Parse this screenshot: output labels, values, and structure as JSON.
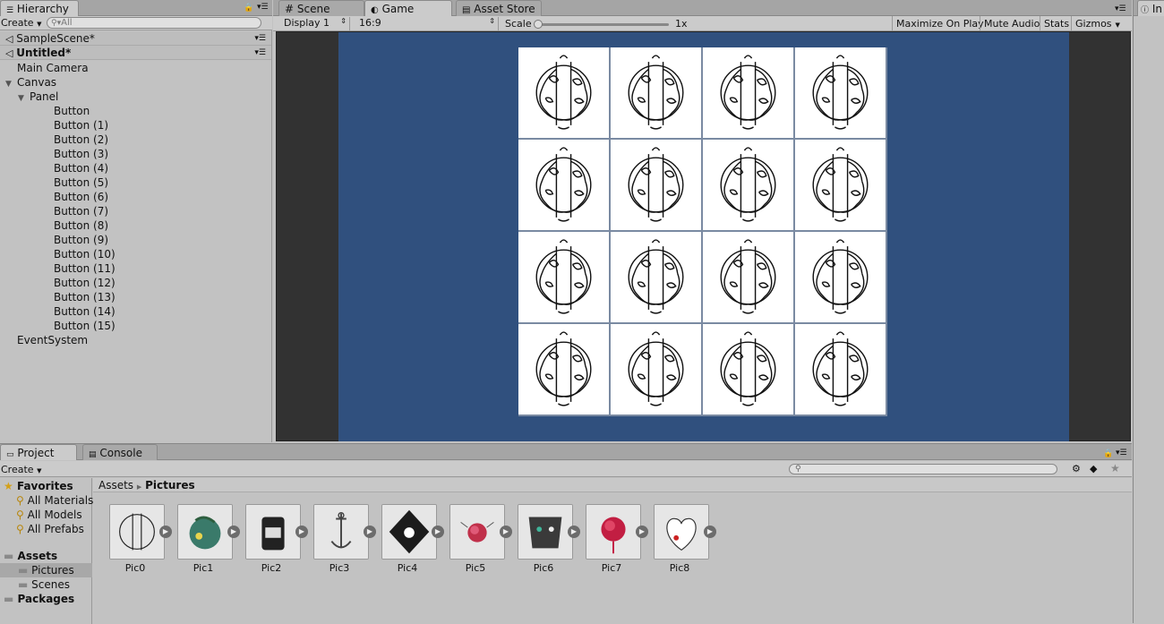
{
  "hierarchy": {
    "tab_label": "Hierarchy",
    "create_label": "Create",
    "search_placeholder": "All",
    "scenes": [
      "SampleScene*",
      "Untitled*"
    ],
    "items": [
      {
        "label": "Main Camera",
        "depth": 0,
        "arrow": ""
      },
      {
        "label": "Canvas",
        "depth": 0,
        "arrow": "▼"
      },
      {
        "label": "Panel",
        "depth": 1,
        "arrow": "▼"
      },
      {
        "label": "Button",
        "depth": 2,
        "arrow": ""
      },
      {
        "label": "Button (1)",
        "depth": 2,
        "arrow": ""
      },
      {
        "label": "Button (2)",
        "depth": 2,
        "arrow": ""
      },
      {
        "label": "Button (3)",
        "depth": 2,
        "arrow": ""
      },
      {
        "label": "Button (4)",
        "depth": 2,
        "arrow": ""
      },
      {
        "label": "Button (5)",
        "depth": 2,
        "arrow": ""
      },
      {
        "label": "Button (6)",
        "depth": 2,
        "arrow": ""
      },
      {
        "label": "Button (7)",
        "depth": 2,
        "arrow": ""
      },
      {
        "label": "Button (8)",
        "depth": 2,
        "arrow": ""
      },
      {
        "label": "Button (9)",
        "depth": 2,
        "arrow": ""
      },
      {
        "label": "Button (10)",
        "depth": 2,
        "arrow": ""
      },
      {
        "label": "Button (11)",
        "depth": 2,
        "arrow": ""
      },
      {
        "label": "Button (12)",
        "depth": 2,
        "arrow": ""
      },
      {
        "label": "Button (13)",
        "depth": 2,
        "arrow": ""
      },
      {
        "label": "Button (14)",
        "depth": 2,
        "arrow": ""
      },
      {
        "label": "Button (15)",
        "depth": 2,
        "arrow": ""
      },
      {
        "label": "EventSystem",
        "depth": 0,
        "arrow": ""
      }
    ]
  },
  "view_tabs": {
    "scene": "Scene",
    "game": "Game",
    "asset_store": "Asset Store"
  },
  "game_toolbar": {
    "display": "Display 1",
    "aspect": "16:9",
    "scale_label": "Scale",
    "scale_value": "1x",
    "maximize": "Maximize On Play",
    "mute": "Mute Audio",
    "stats": "Stats",
    "gizmos": "Gizmos"
  },
  "inspector_tab": "In",
  "game_view": {
    "background": "#30507e",
    "grid_rows": 4,
    "grid_cols": 4
  },
  "bottom_tabs": {
    "project": "Project",
    "console": "Console"
  },
  "project": {
    "create_label": "Create",
    "favorites_label": "Favorites",
    "favorites": [
      "All Materials",
      "All Models",
      "All Prefabs"
    ],
    "assets_label": "Assets",
    "asset_folders": [
      "Pictures",
      "Scenes"
    ],
    "packages_label": "Packages",
    "breadcrumb": [
      "Assets",
      "Pictures"
    ],
    "pictures": [
      "Pic0",
      "Pic1",
      "Pic2",
      "Pic3",
      "Pic4",
      "Pic5",
      "Pic6",
      "Pic7",
      "Pic8"
    ]
  }
}
